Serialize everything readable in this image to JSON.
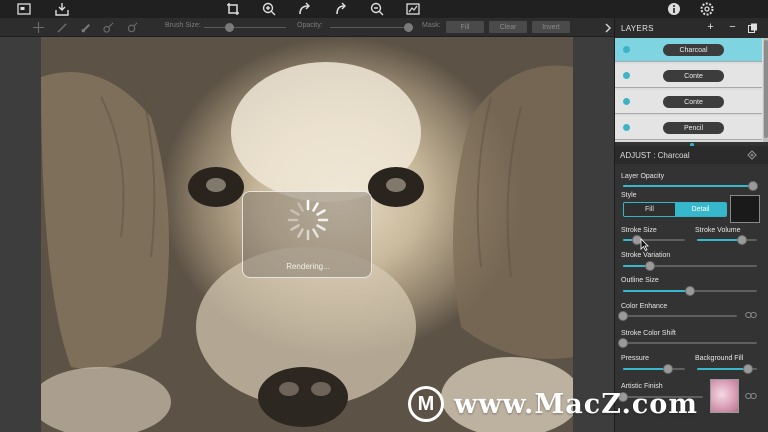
{
  "toolbar": {
    "icons": [
      "image-frame-icon",
      "import-tray-icon",
      "crop-icon",
      "zoom-in-icon",
      "undo-icon",
      "redo-icon",
      "zoom-out-icon",
      "fit-screen-icon",
      "info-icon",
      "settings-icon"
    ]
  },
  "brush_bar": {
    "brush_size_label": "Brush Size:",
    "brush_size_level": 0.3,
    "opacity_label": "Opacity:",
    "opacity_level": 0.97,
    "mask_label": "Mask:",
    "fill_button": "Fill",
    "clear_button": "Clear",
    "invert_button": "Invert"
  },
  "canvas": {
    "rendering_text": "Rendering...",
    "panel_toggle_glyph": "›"
  },
  "layers_panel": {
    "title": "LAYERS",
    "add_glyph": "+",
    "remove_glyph": "−",
    "layers": [
      {
        "name": "Charcoal",
        "selected": true
      },
      {
        "name": "Conte",
        "selected": false
      },
      {
        "name": "Conte",
        "selected": false
      },
      {
        "name": "Pencil",
        "selected": false
      }
    ]
  },
  "adjust_panel": {
    "title": "ADJUST : Charcoal",
    "layer_opacity_label": "Layer Opacity",
    "layer_opacity": 0.97,
    "style_label": "Style",
    "style_fill": "Fill",
    "style_detail": "Detail",
    "style_selected": "Detail",
    "stroke_size_label": "Stroke Size",
    "stroke_size": 0.22,
    "stroke_volume_label": "Stroke Volume",
    "stroke_volume": 0.75,
    "stroke_variation_label": "Stroke Variation",
    "stroke_variation": 0.2,
    "outline_size_label": "Outline Size",
    "outline_size": 0.5,
    "color_enhance_label": "Color Enhance",
    "color_enhance": 0.0,
    "stroke_color_shift_label": "Stroke Color Shift",
    "stroke_color_shift": 0.0,
    "pressure_label": "Pressure",
    "pressure": 0.72,
    "background_fill_label": "Background Fill",
    "background_fill": 0.85,
    "artistic_finish_label": "Artistic Finish",
    "artistic_finish": 0.0
  },
  "watermark": {
    "logo_letter": "M",
    "text": "www.MacZ.com"
  },
  "colors": {
    "accent": "#38b8cc",
    "panel_bg": "#333333",
    "toolbar_bg": "#202020"
  }
}
